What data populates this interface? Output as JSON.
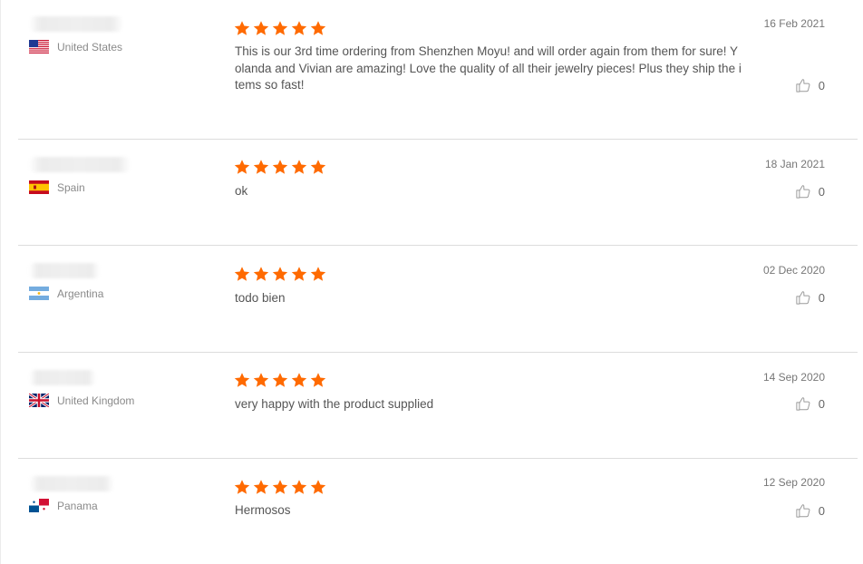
{
  "colors": {
    "star": "#ff6a00",
    "divider": "#dcdcdc",
    "text": "#555555"
  },
  "reviews": [
    {
      "country": "United States",
      "flag": "us-flag",
      "stars": 5,
      "date": "16 Feb 2021",
      "text": "This is our 3rd time ordering from Shenzhen Moyu! and will order again from them for sure! Yolanda and Vivian are amazing! Love the quality of all their jewelry pieces! Plus they ship the items so fast!",
      "likes": "0"
    },
    {
      "country": "Spain",
      "flag": "spain-flag",
      "stars": 5,
      "date": "18 Jan 2021",
      "text": "ok",
      "likes": "0"
    },
    {
      "country": "Argentina",
      "flag": "argentina-flag",
      "stars": 5,
      "date": "02 Dec 2020",
      "text": "todo bien",
      "likes": "0"
    },
    {
      "country": "United Kingdom",
      "flag": "uk-flag",
      "stars": 5,
      "date": "14 Sep 2020",
      "text": "very happy with the product supplied",
      "likes": "0"
    },
    {
      "country": "Panama",
      "flag": "panama-flag",
      "stars": 5,
      "date": "12 Sep 2020",
      "text": "Hermosos",
      "likes": "0"
    }
  ]
}
